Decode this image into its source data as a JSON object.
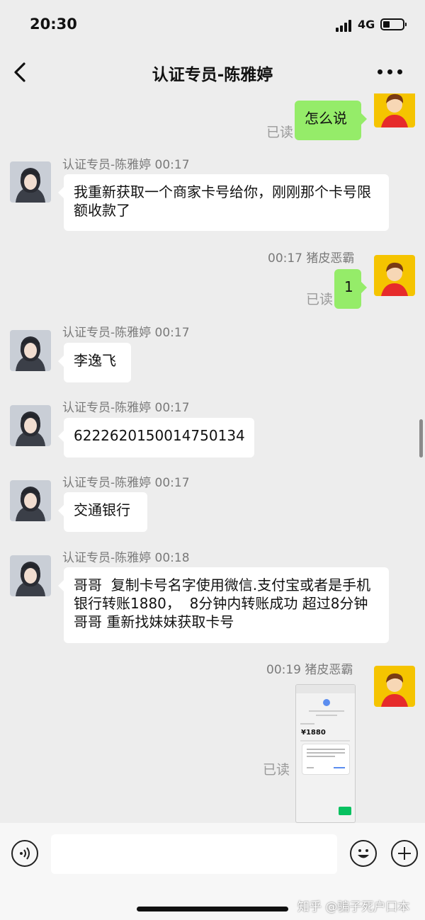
{
  "status_bar": {
    "time": "20:30",
    "network": "4G"
  },
  "header": {
    "title": "认证专员-陈雅婷"
  },
  "read_label": "已读",
  "messages": [
    {
      "sender_line": "",
      "text": "怎么说"
    },
    {
      "sender_line": "认证专员-陈雅婷  00:17",
      "text": "我重新获取一个商家卡号给你，刚刚那个卡号限额收款了"
    },
    {
      "sender_line": "00:17  猪皮恶霸",
      "text": "1"
    },
    {
      "sender_line": "认证专员-陈雅婷  00:17",
      "text": "李逸飞"
    },
    {
      "sender_line": "认证专员-陈雅婷  00:17",
      "text": "6222620150014750134"
    },
    {
      "sender_line": "认证专员-陈雅婷  00:17",
      "text": "交通银行"
    },
    {
      "sender_line": "认证专员-陈雅婷  00:18",
      "text": "哥哥  复制卡号名字使用微信.支付宝或者是手机银行转账1880，  8分钟内转账成功 超过8分钟 哥哥 重新找妹妹获取卡号"
    },
    {
      "sender_line": "00:19  猪皮恶霸",
      "text": ""
    }
  ],
  "shared_image": {
    "amount": "¥1880"
  },
  "watermark": "知乎 @骗子死户口本",
  "colors": {
    "outgoing_bubble": "#95ec69",
    "background": "#ededed"
  }
}
